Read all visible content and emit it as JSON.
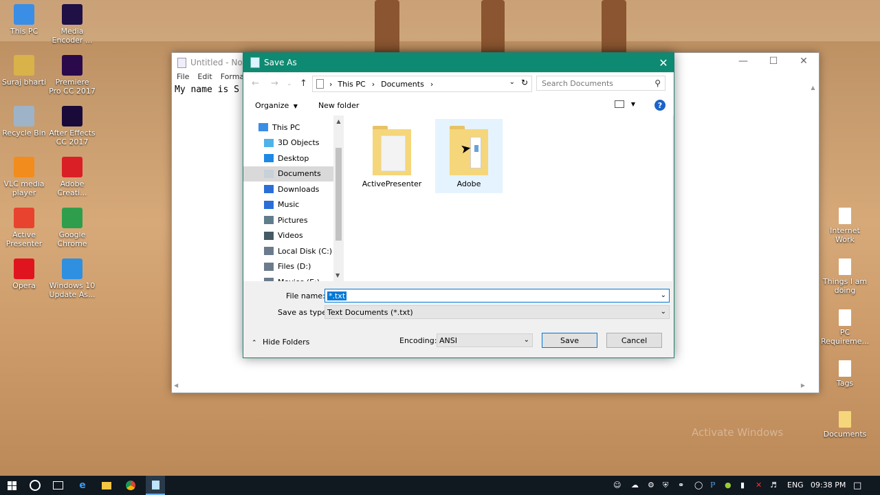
{
  "desktop": {
    "left_icons": [
      {
        "label": "This PC",
        "color": "#3a8ee6"
      },
      {
        "label": "Media Encoder ...",
        "color": "#1f1046"
      },
      {
        "label": "Suraj bharti",
        "color": "#d9b24a"
      },
      {
        "label": "Premiere Pro CC 2017",
        "color": "#2a0a4a"
      },
      {
        "label": "Recycle Bin",
        "color": "#9fb3c8"
      },
      {
        "label": "After Effects CC 2017",
        "color": "#1a0a3a"
      },
      {
        "label": "VLC media player",
        "color": "#f28c1c"
      },
      {
        "label": "Adobe Creati...",
        "color": "#da1f26"
      },
      {
        "label": "Active Presenter",
        "color": "#e8432e"
      },
      {
        "label": "Google Chrome",
        "color": "#2e9e4d"
      },
      {
        "label": "Opera",
        "color": "#e0141e"
      },
      {
        "label": "Windows 10 Update As...",
        "color": "#2f8fe0"
      }
    ],
    "right_icons": [
      {
        "label": "Internet Work"
      },
      {
        "label": "Things I am doing"
      },
      {
        "label": "PC Requireme..."
      },
      {
        "label": "Tags"
      },
      {
        "label": "Documents"
      }
    ],
    "watermark": "Activate Windows"
  },
  "notepad": {
    "title": "Untitled - Note",
    "menu": [
      "File",
      "Edit",
      "Format"
    ],
    "text": "My name is S"
  },
  "dialog": {
    "title": "Save As",
    "breadcrumb": [
      "This PC",
      "Documents"
    ],
    "search_placeholder": "Search Documents",
    "toolbar": {
      "organize": "Organize",
      "new_folder": "New folder"
    },
    "nav_items": [
      {
        "label": "This PC",
        "icon": "this-pc-icon",
        "color": "#3a8ee6"
      },
      {
        "label": "3D Objects",
        "icon": "3d-objects-icon",
        "color": "#4fb3e8"
      },
      {
        "label": "Desktop",
        "icon": "desktop-icon",
        "color": "#1e88e5"
      },
      {
        "label": "Documents",
        "icon": "documents-icon",
        "color": "#c8d0d8"
      },
      {
        "label": "Downloads",
        "icon": "downloads-icon",
        "color": "#2b6fd6"
      },
      {
        "label": "Music",
        "icon": "music-icon",
        "color": "#2b6fd6"
      },
      {
        "label": "Pictures",
        "icon": "pictures-icon",
        "color": "#607d8b"
      },
      {
        "label": "Videos",
        "icon": "videos-icon",
        "color": "#455a64"
      },
      {
        "label": "Local Disk (C:)",
        "icon": "local-disk-icon",
        "color": "#6b7b8b"
      },
      {
        "label": "Files (D:)",
        "icon": "drive-icon",
        "color": "#6b7b8b"
      },
      {
        "label": "Movies (E:)",
        "icon": "drive-icon",
        "color": "#6b7b8b"
      }
    ],
    "folders": [
      {
        "label": "ActivePresenter"
      },
      {
        "label": "Adobe"
      }
    ],
    "file_name_label": "File name:",
    "file_name_value": "*.txt",
    "save_type_label": "Save as type:",
    "save_type_value": "Text Documents (*.txt)",
    "hide_folders": "Hide Folders",
    "encoding_label": "Encoding:",
    "encoding_value": "ANSI",
    "save": "Save",
    "cancel": "Cancel"
  },
  "taskbar": {
    "lang": "ENG",
    "time": "09:38 PM"
  }
}
